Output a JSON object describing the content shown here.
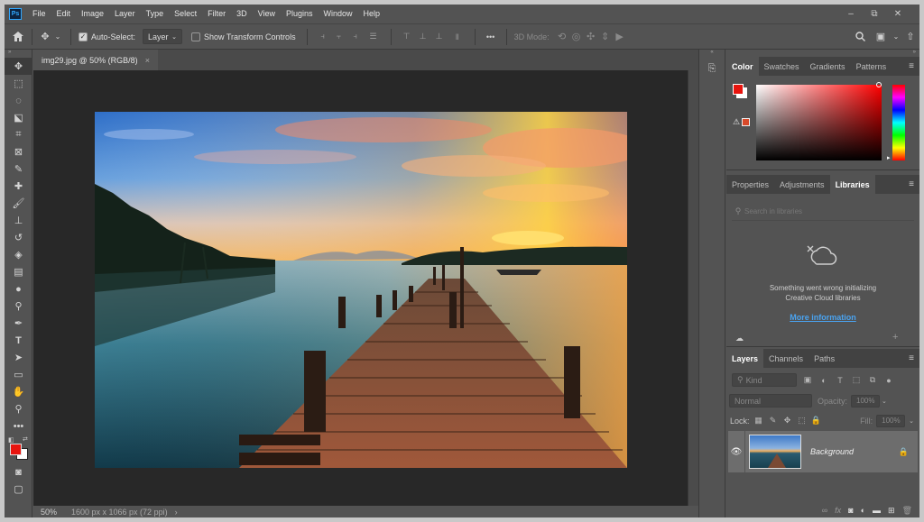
{
  "app": {
    "logo_text": "Ps"
  },
  "menu": [
    "File",
    "Edit",
    "Image",
    "Layer",
    "Type",
    "Select",
    "Filter",
    "3D",
    "View",
    "Plugins",
    "Window",
    "Help"
  ],
  "window_controls": {
    "minimize": "–",
    "restore": "⧉",
    "close": "✕"
  },
  "options_bar": {
    "auto_select_label": "Auto-Select:",
    "auto_select_checked": true,
    "auto_select_target": "Layer",
    "show_transform_label": "Show Transform Controls",
    "show_transform_checked": false,
    "more_label": "•••",
    "mode_3d_label": "3D Mode:"
  },
  "document": {
    "tab_title": "img29.jpg @ 50% (RGB/8)",
    "tab_close": "×"
  },
  "status": {
    "zoom": "50%",
    "info": "1600 px x 1066 px (72 ppi)",
    "arrow": "›"
  },
  "color_panel": {
    "tabs": [
      "Color",
      "Swatches",
      "Gradients",
      "Patterns"
    ],
    "active_tab": "Color",
    "foreground_color": "#e8140e",
    "background_color": "#ffffff"
  },
  "properties_panel": {
    "tabs": [
      "Properties",
      "Adjustments",
      "Libraries"
    ],
    "active_tab": "Libraries",
    "search_placeholder": "Search in libraries",
    "error_line1": "Something went wrong initializing",
    "error_line2": "Creative Cloud libraries",
    "more_info_link": "More information"
  },
  "layers_panel": {
    "tabs": [
      "Layers",
      "Channels",
      "Paths"
    ],
    "active_tab": "Layers",
    "filter_label": "Kind",
    "blend_mode": "Normal",
    "opacity_label": "Opacity:",
    "opacity_value": "100%",
    "lock_label": "Lock:",
    "fill_label": "Fill:",
    "fill_value": "100%",
    "layers": [
      {
        "name": "Background",
        "visible": true,
        "locked": true
      }
    ],
    "footer_icons": [
      "link-icon",
      "fx-icon",
      "mask-icon",
      "adjustment-icon",
      "group-icon",
      "new-layer-icon",
      "trash-icon"
    ]
  },
  "colors": {
    "accent_link": "#4aa3f0",
    "panel_bg": "#535353",
    "canvas_bg": "#282828",
    "selected_layer": "#6d6d6d"
  }
}
